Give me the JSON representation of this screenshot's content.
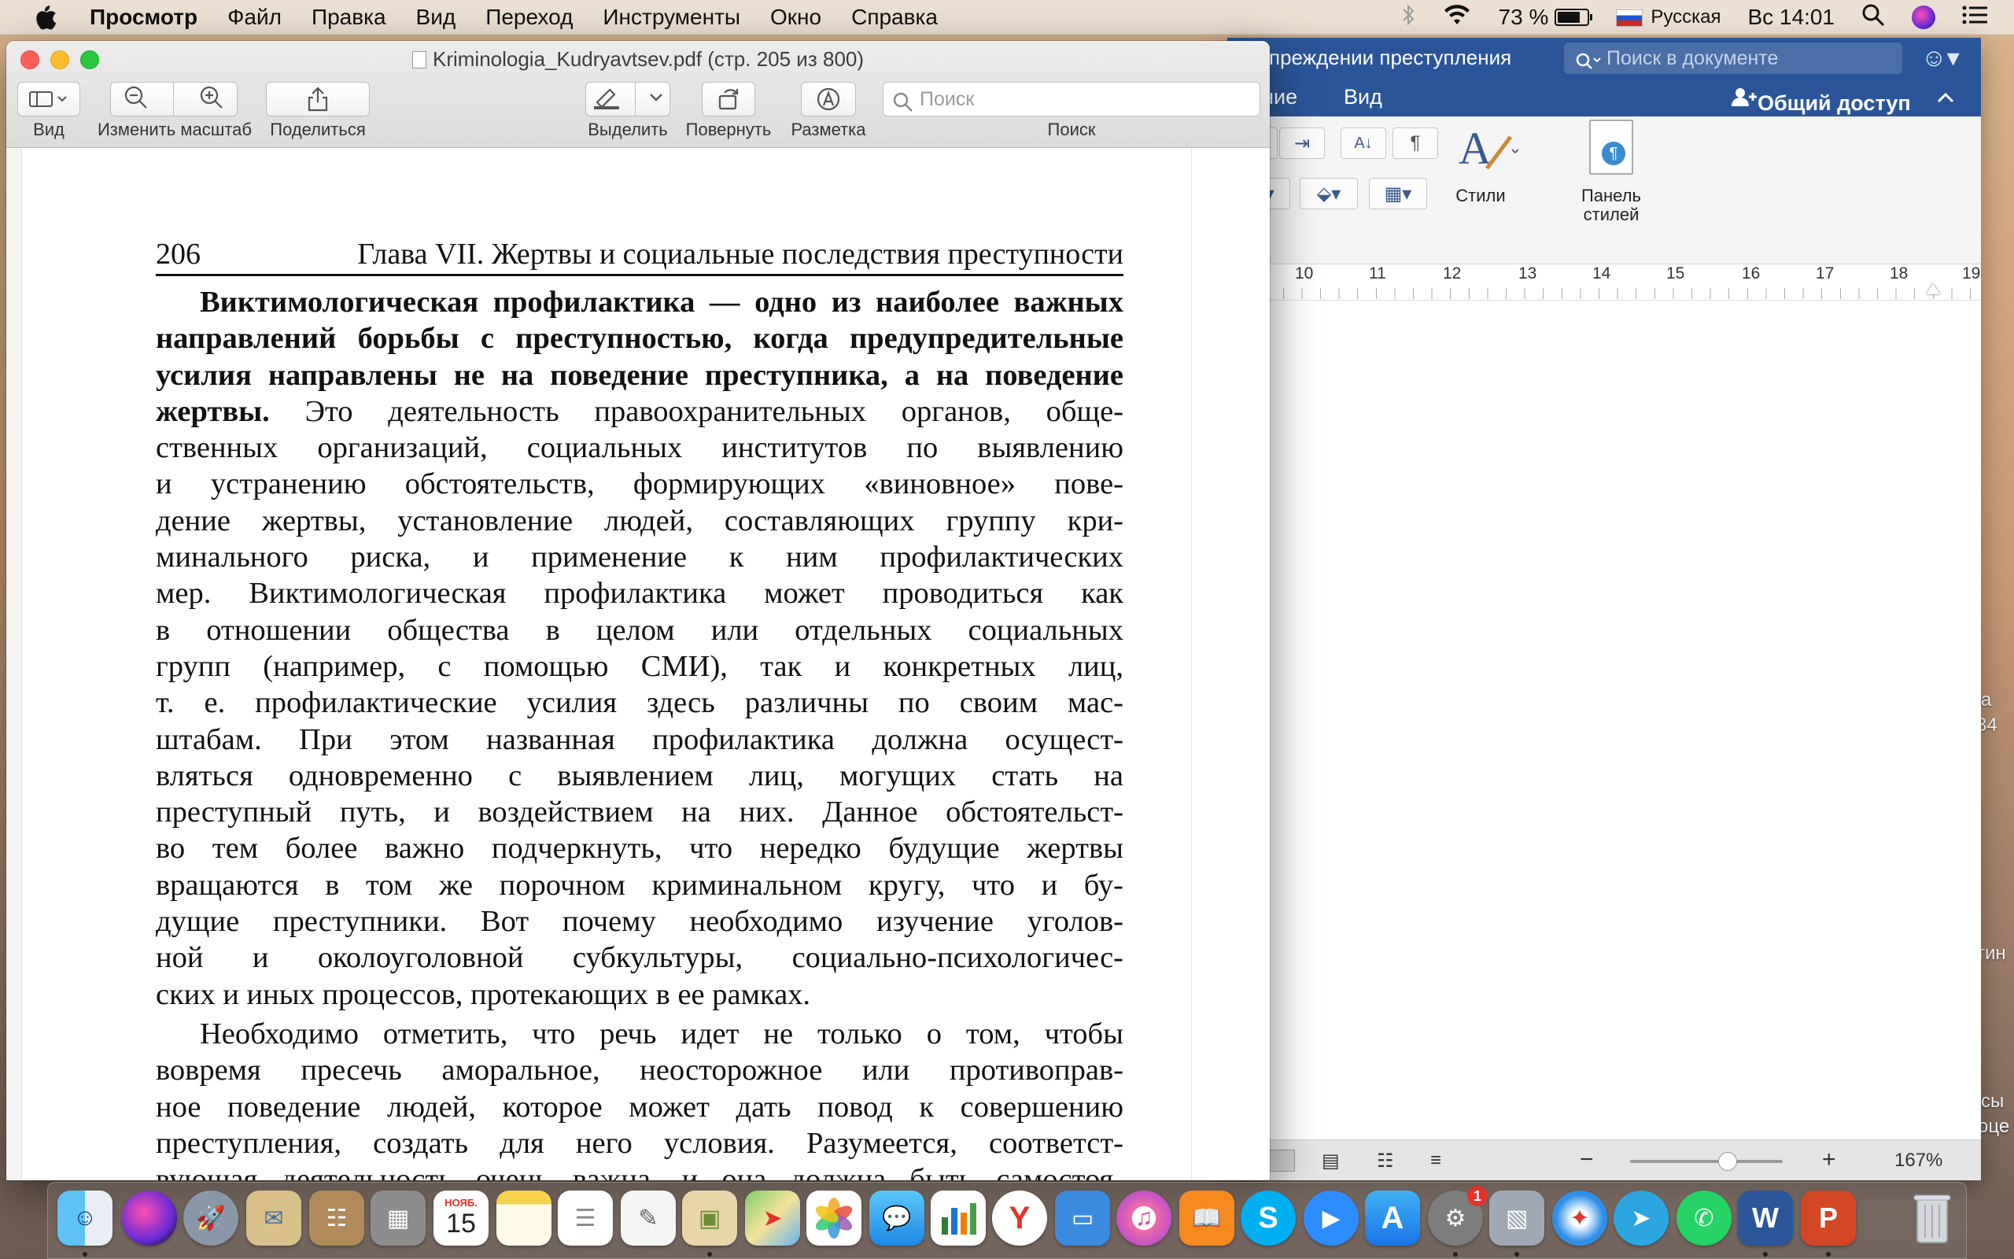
{
  "menubar": {
    "app_name": "Просмотр",
    "menus": [
      "Файл",
      "Правка",
      "Вид",
      "Переход",
      "Инструменты",
      "Окно",
      "Справка"
    ],
    "battery": "73 %",
    "input_source": "Русская",
    "clock": "Вс 14:01"
  },
  "preview": {
    "title": "Kriminologia_Kudryavtsev.pdf (стр. 205 из 800)",
    "toolbar": {
      "view_label": "Вид",
      "zoom_label": "Изменить масштаб",
      "share_label": "Поделиться",
      "highlight_label": "Выделить",
      "rotate_label": "Повернуть",
      "markup_label": "Разметка",
      "search_label": "Поиск",
      "search_placeholder": "Поиск"
    },
    "page": {
      "number": "206",
      "chapter": "Глава VII. Жертвы и социальные последствия преступности",
      "para1_bold_lines": [
        "Виктимологическая профилактика — одно из наиболее важных",
        "направлений борьбы с преступностью, когда предупредительные",
        "усилия направлены не на поведение преступника, а на поведение"
      ],
      "para1_mixed_bold": "жертвы.",
      "para1_mixed_rest": " Это деятельность правоохранительных органов, обще-",
      "para1_lines": [
        "ственных организаций, социальных институтов по выявлению",
        "и устранению обстоятельств, формирующих «виновное» пове-",
        "дение жертвы, установление людей, составляющих группу кри-",
        "минального риска, и применение к ним профилактических",
        "мер. Виктимологическая профилактика может проводиться как",
        "в отношении общества в целом или отдельных социальных",
        "групп (например, с помощью СМИ), так и конкретных лиц,",
        "т. е. профилактические усилия здесь различны по своим мас-",
        "штабам. При этом названная профилактика должна осущест-",
        "вляться одновременно с выявлением лиц, могущих стать на",
        "преступный путь, и воздействием на них. Данное обстоятельст-",
        "во тем более важно подчеркнуть, что нередко будущие жертвы",
        "вращаются в том же порочном криминальном кругу, что и бу-",
        "дущие преступники. Вот почему необходимо изучение уголов-",
        "ной и околоуголовной субкультуры, социально-психологичес-",
        "ских и иных процессов, протекающих в ее рамках."
      ],
      "para2_lines": [
        "Необходимо отметить, что речь идет не только о том, чтобы",
        "вовремя пресечь аморальное, неосторожное или противоправ-",
        "ное поведение людей, которое может дать повод к совершению",
        "преступления, создать для него условия. Разумеется, соответст-",
        "вующая деятельность очень важна, и она должна быть самостоя-"
      ]
    }
  },
  "word": {
    "doc_title": "упреждении преступления",
    "search_placeholder": "Поиск в документе",
    "tabs": [
      "ование",
      "Вид"
    ],
    "share_label": "Общий доступ",
    "styles_label": "Стили",
    "styles_pane_label_1": "Панель",
    "styles_pane_label_2": "стилей",
    "ruler_numbers": [
      "10",
      "11",
      "12",
      "13",
      "14",
      "15",
      "16",
      "17",
      "18",
      "19"
    ],
    "zoom": "167%"
  },
  "wallpaper_text": [
    "а",
    "34",
    "тин",
    "сы",
    "оце"
  ],
  "dock": {
    "calendar_month": "НОЯБ.",
    "calendar_day": "15",
    "badge": "1"
  }
}
